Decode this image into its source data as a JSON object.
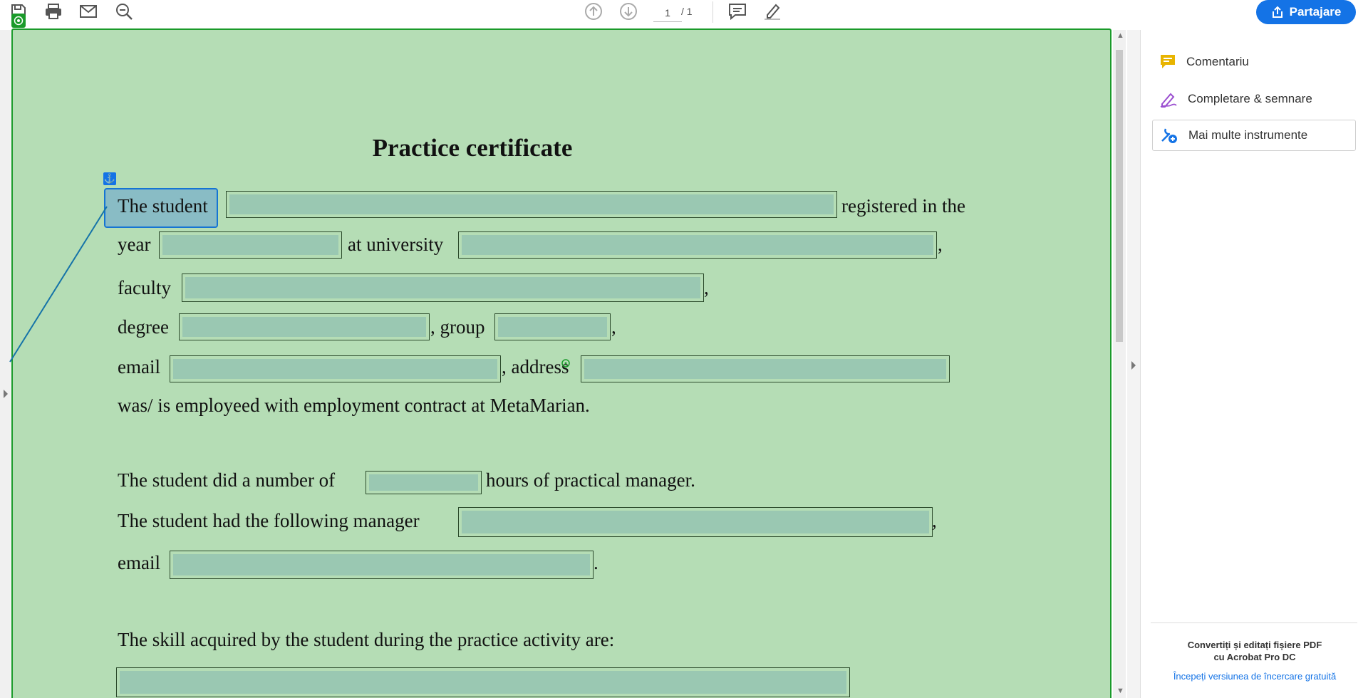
{
  "toolbar": {
    "icons": [
      "save-icon",
      "print-icon",
      "mail-icon",
      "zoom-icon",
      "prev-page-icon",
      "next-page-icon",
      "comment-icon",
      "highlight-icon"
    ],
    "page_current": "1",
    "page_total": "/ 1",
    "share_label": "Partajare"
  },
  "document": {
    "title": "Practice certificate",
    "lines": {
      "student_prefix": "The student",
      "registered_suffix": "registered in the",
      "year": "year",
      "at_university": "at university",
      "comma1": ",",
      "faculty": "faculty",
      "comma2": ",",
      "degree": "degree",
      "group": ", group",
      "comma3": ",",
      "email": "email",
      "address": ", address",
      "employed": "was/ is employeed with employment contract at MetaMarian.",
      "hours_prefix": "The student did a number of",
      "hours_suffix": "hours of practical manager.",
      "manager_prefix": "The student had the following manager",
      "comma4": ",",
      "email2": "email",
      "period": ".",
      "skills": "The skill acquired by the student during the practice activity are:"
    }
  },
  "panel": {
    "items": [
      {
        "label": "Comentariu",
        "icon": "comment-icon",
        "color": "#e8b400"
      },
      {
        "label": "Completare & semnare",
        "icon": "sign-icon",
        "color": "#9b4fd0"
      },
      {
        "label": "Mai multe instrumente",
        "icon": "tools-icon",
        "color": "#1473e6"
      }
    ],
    "promo_title_1": "Convertiți și editați fișiere PDF",
    "promo_title_2": "cu Acrobat Pro DC",
    "promo_link": "Începeți versiunea de încercare gratuită"
  },
  "colors": {
    "accent": "#1473e6",
    "form_highlight": "#b5ddb5",
    "form_border": "#1a9a2a"
  }
}
